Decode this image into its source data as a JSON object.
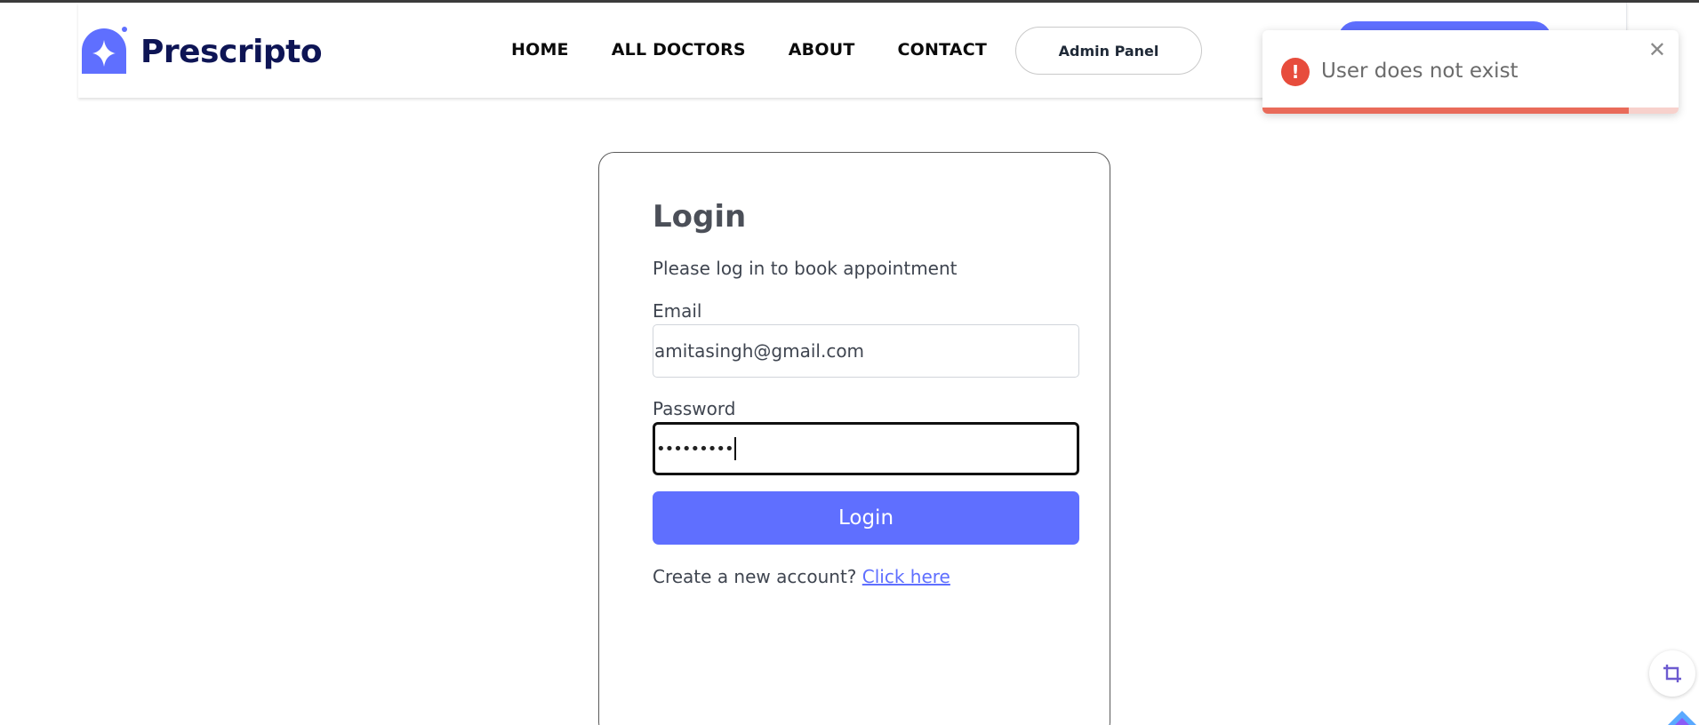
{
  "brand": {
    "name": "Prescripto",
    "color": "#5f6fff",
    "text_color": "#0e1555"
  },
  "nav": {
    "items": [
      {
        "label": "HOME"
      },
      {
        "label": "ALL DOCTORS"
      },
      {
        "label": "ABOUT"
      },
      {
        "label": "CONTACT"
      }
    ],
    "admin_label": "Admin Panel"
  },
  "toast": {
    "type": "error",
    "icon": "error-icon",
    "icon_glyph": "!",
    "message": "User does not exist",
    "close_glyph": "✕",
    "progress_fraction": 0.88,
    "accent": "#e74c3c"
  },
  "login": {
    "title": "Login",
    "subtitle": "Please log in to book appointment",
    "email_label": "Email",
    "email_value": "amitasingh@gmail.com",
    "password_label": "Password",
    "password_mask": "•••••••••",
    "button_label": "Login",
    "create_prompt": "Create a new account?",
    "create_link": "Click here"
  },
  "widgets": {
    "crop_icon": "crop-icon"
  }
}
